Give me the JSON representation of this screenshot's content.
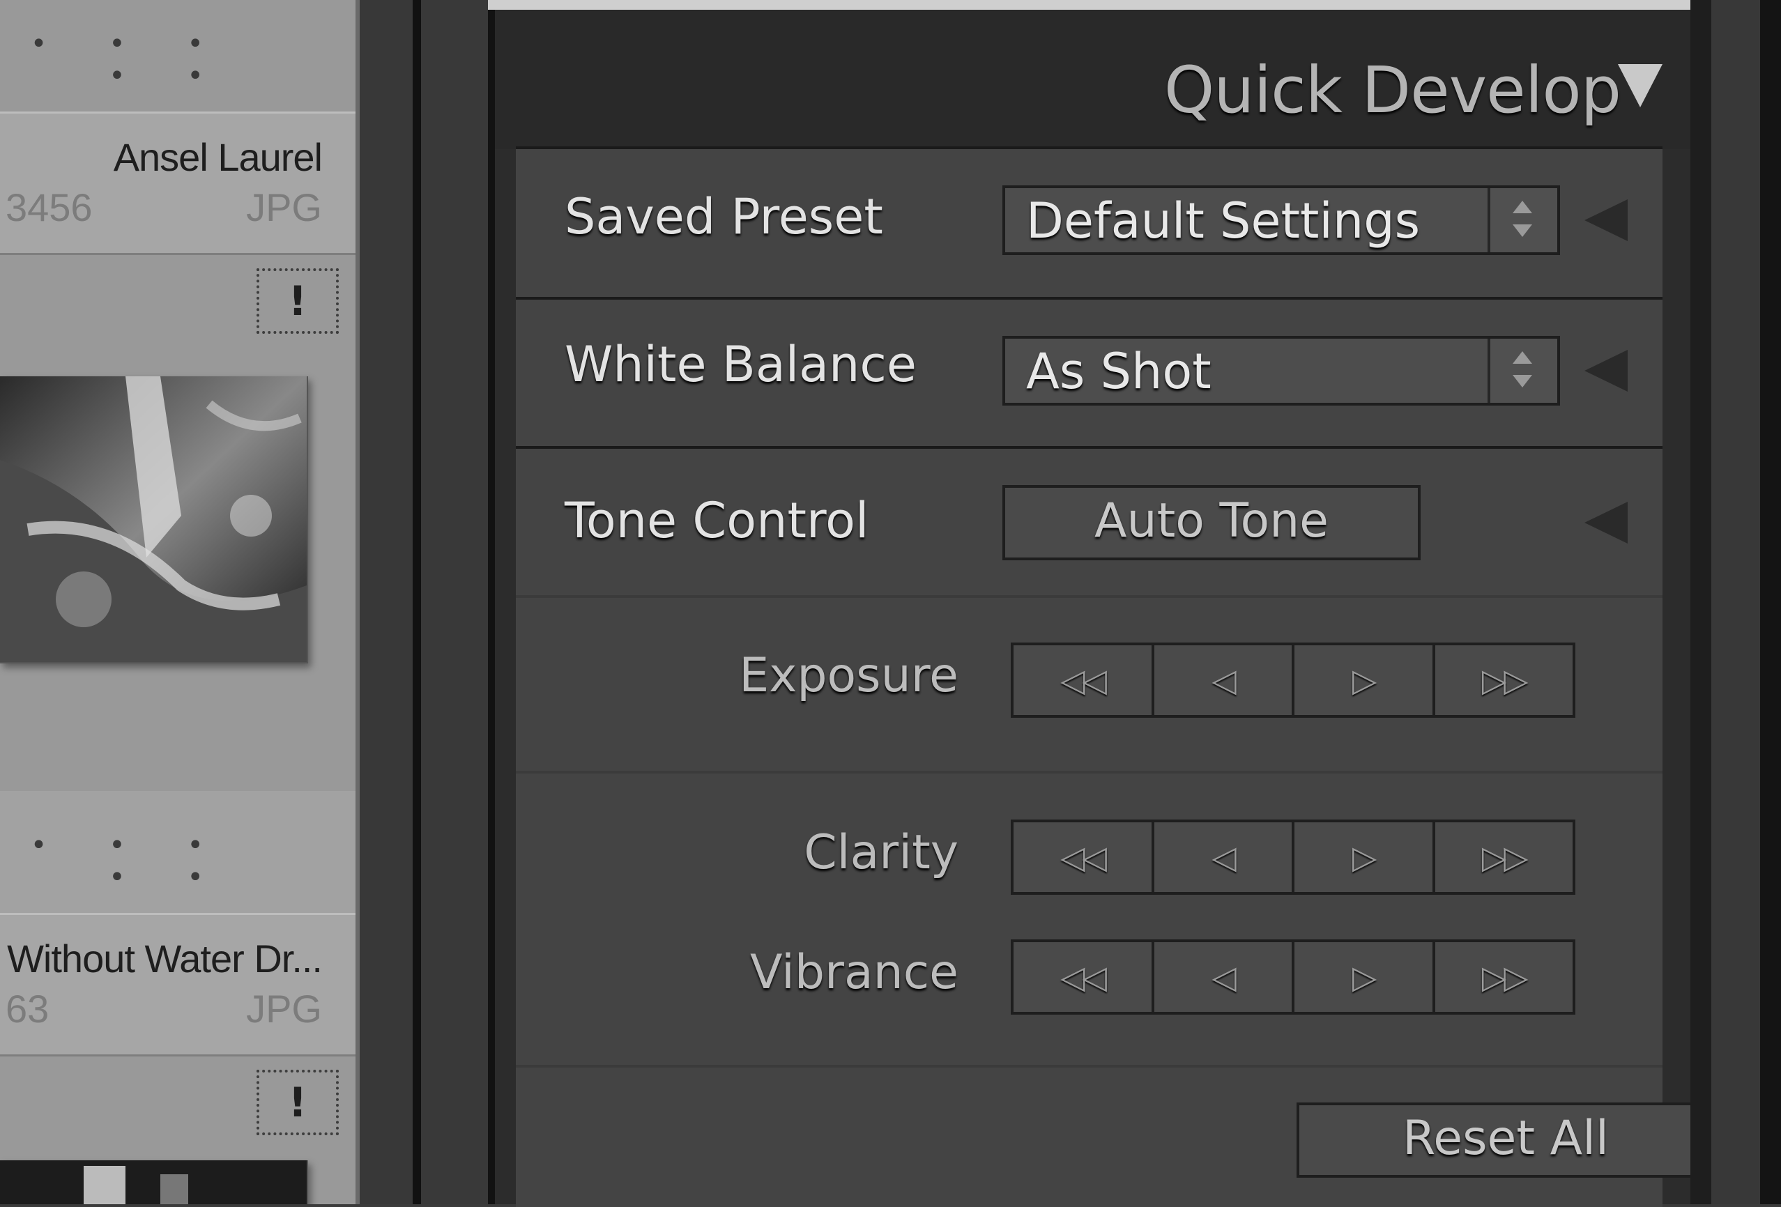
{
  "grid": {
    "top_stars": "• • • • •",
    "cell1": {
      "name": "Ansel Laurel",
      "dims": "3456",
      "format": "JPG",
      "flag": "!"
    },
    "mid_stars": "• • • • •",
    "cell2": {
      "name": "Without Water Dr...",
      "dims": "63",
      "format": "JPG",
      "flag": "!"
    }
  },
  "panel": {
    "title": "Quick Develop",
    "saved_preset": {
      "label": "Saved Preset",
      "value": "Default Settings"
    },
    "white_balance": {
      "label": "White Balance",
      "value": "As Shot"
    },
    "tone_control": {
      "label": "Tone Control",
      "button": "Auto Tone"
    },
    "steppers": [
      {
        "label": "Exposure",
        "glyphs": [
          "◁◁",
          "◁",
          "▷",
          "▷▷"
        ]
      },
      {
        "label": "Clarity",
        "glyphs": [
          "◁◁",
          "◁",
          "▷",
          "▷▷"
        ]
      },
      {
        "label": "Vibrance",
        "glyphs": [
          "◁◁",
          "◁",
          "▷",
          "▷▷"
        ]
      }
    ],
    "reset_all": "Reset All"
  },
  "colors": {
    "panel_bg": "#2c2c2c",
    "section_bg": "#444444",
    "grid_cell_bg": "#999999"
  }
}
